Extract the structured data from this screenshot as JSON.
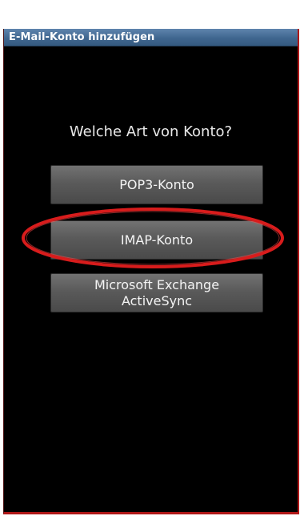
{
  "dialog": {
    "title": "E-Mail-Konto hinzufügen",
    "prompt": "Welche Art von Konto?"
  },
  "buttons": {
    "pop3": "POP3-Konto",
    "imap": "IMAP-Konto",
    "exchange": "Microsoft Exchange\nActiveSync"
  },
  "colors": {
    "titlebar": "#3f668f",
    "background": "#000000",
    "button": "#5a5a5a",
    "highlight": "#d81c1c"
  }
}
